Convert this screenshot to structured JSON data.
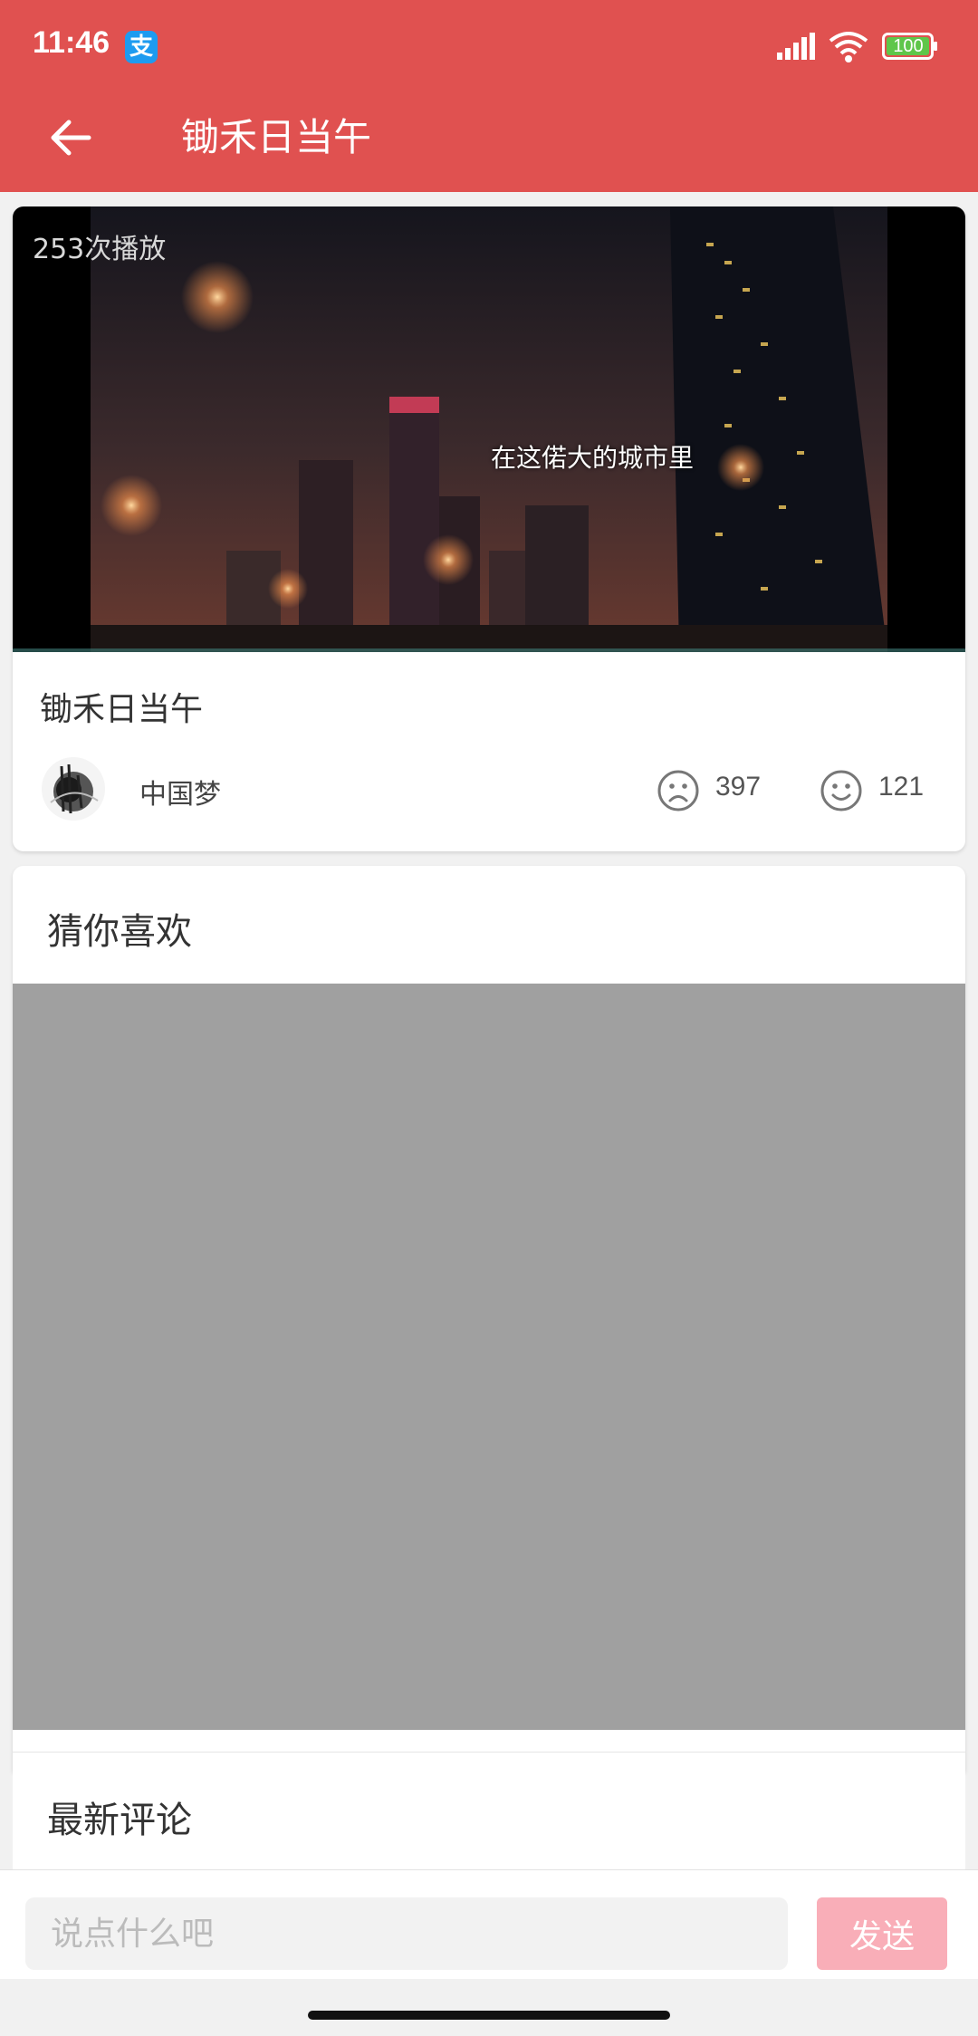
{
  "status_bar": {
    "time": "11:46",
    "battery_level": "100",
    "icons": [
      "alipay-icon",
      "signal-icon",
      "wifi-icon",
      "battery-icon"
    ]
  },
  "appbar": {
    "title": "锄禾日当午",
    "back_icon": "arrow-left-icon",
    "background_color": "#e05150"
  },
  "video": {
    "play_count": "253次播放",
    "subtitle": "在这偌大的城市里",
    "title": "锄禾日当午",
    "author": "中国梦",
    "dislike_count": "397",
    "like_count": "121",
    "dislike_icon": "sad-face-icon",
    "like_icon": "smile-face-icon"
  },
  "recommend": {
    "title": "猜你喜欢"
  },
  "comments": {
    "title": "最新评论"
  },
  "comment_bar": {
    "placeholder": "说点什么吧",
    "send_label": "发送",
    "send_color": "#f9aeb8"
  }
}
